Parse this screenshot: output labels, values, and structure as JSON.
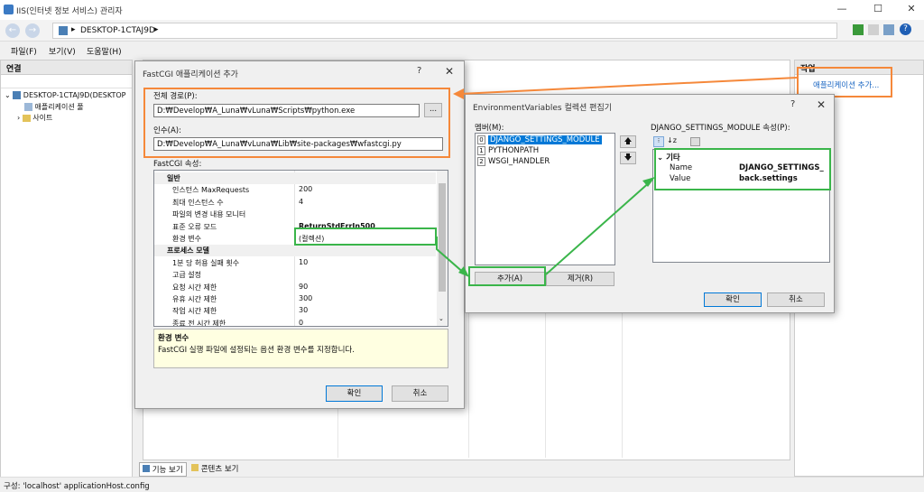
{
  "window": {
    "title": "IIS(인터넷 정보 서비스) 관리자",
    "minimize": "—",
    "maximize": "☐",
    "close": "✕"
  },
  "address": {
    "crumb": "DESKTOP-1CTAJ9D",
    "arrow": "▸"
  },
  "menu": {
    "items": [
      "파일(F)",
      "보기(V)",
      "도움말(H)"
    ]
  },
  "left_pane": {
    "header": "연결",
    "tree": [
      "DESKTOP-1CTAJ9D(DESKTOP",
      "애플리케이션 풀",
      "사이트"
    ]
  },
  "right_pane": {
    "header": "작업",
    "action": "애플리케이션 추가..."
  },
  "bottom_tabs": [
    "기능 보기",
    "콘텐츠 보기"
  ],
  "status": "구성: 'localhost' applicationHost.config",
  "fastcgi_dialog": {
    "title": "FastCGI 애플리케이션 추가",
    "q": "?",
    "x": "✕",
    "path_label": "전체 경로(P):",
    "path_value": "D:₩Develop₩A_Luna₩vLuna₩Scripts₩python.exe",
    "browse": "...",
    "args_label": "인수(A):",
    "args_value": "D:₩Develop₩A_Luna₩vLuna₩Lib₩site-packages₩wfastcgi.py",
    "props_label": "FastCGI 속성:",
    "props": [
      {
        "key": "일반",
        "value": "",
        "section": true
      },
      {
        "key": "인스턴스 MaxRequests",
        "value": "200"
      },
      {
        "key": "최대 인스턴스 수",
        "value": "4"
      },
      {
        "key": "파일의 변경 내용 모니터",
        "value": ""
      },
      {
        "key": "표준 오류 모드",
        "value": "ReturnStdErrIn500"
      },
      {
        "key": "환경 변수",
        "value": "(컬렉션)"
      },
      {
        "key": "프로세스 모델",
        "value": "",
        "section": true
      },
      {
        "key": "1분 당 허용 실패 횟수",
        "value": "10"
      },
      {
        "key": "고급 설정",
        "value": ""
      },
      {
        "key": "요청 시간 제한",
        "value": "90"
      },
      {
        "key": "유휴 시간 제한",
        "value": "300"
      },
      {
        "key": "작업 시간 제한",
        "value": "30"
      },
      {
        "key": "종료 전 시간 제한",
        "value": "0"
      }
    ],
    "desc_title": "환경 변수",
    "desc_text": "FastCGI 실행 파일에 설정되는 옵션 환경 변수를 지정합니다.",
    "ok": "확인",
    "cancel": "취소"
  },
  "env_dialog": {
    "title": "EnvironmentVariables 컬렉션 편집기",
    "q": "?",
    "x": "✕",
    "members_label": "멤버(M):",
    "members": [
      {
        "idx": "0",
        "name": "DJANGO_SETTINGS_MODULE"
      },
      {
        "idx": "1",
        "name": "PYTHONPATH"
      },
      {
        "idx": "2",
        "name": "WSGI_HANDLER"
      }
    ],
    "up": "🡅",
    "down": "🡇",
    "add": "추가(A)",
    "remove": "제거(R)",
    "props_label": "DJANGO_SETTINGS_MODULE 속성(P):",
    "category": "기타",
    "name_key": "Name",
    "name_value": "DJANGO_SETTINGS_",
    "value_key": "Value",
    "value_value": "back.settings",
    "ok": "확인",
    "cancel": "취소"
  }
}
